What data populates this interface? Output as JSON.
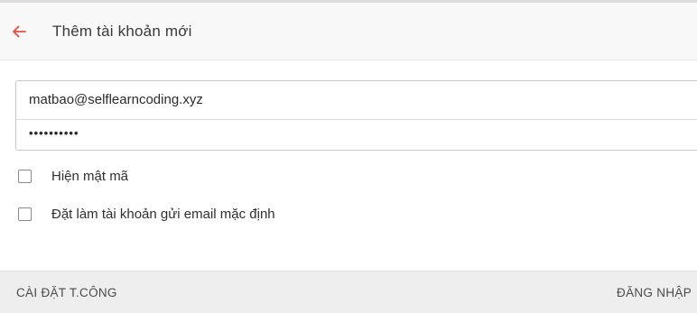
{
  "header": {
    "title": "Thêm tài khoản mới",
    "back_icon": "arrow-left-icon",
    "back_icon_color": "#e94e3c"
  },
  "form": {
    "email_value": "matbao@selflearncoding.xyz",
    "password_mask": "••••••••••"
  },
  "options": {
    "show_password_label": "Hiện mật mã",
    "show_password_checked": false,
    "default_account_label": "Đặt làm tài khoản gửi email mặc định",
    "default_account_checked": false
  },
  "footer": {
    "manual_setup_label": "CÀI ĐẶT T.CÔNG",
    "login_label": "ĐĂNG NHẬP"
  }
}
